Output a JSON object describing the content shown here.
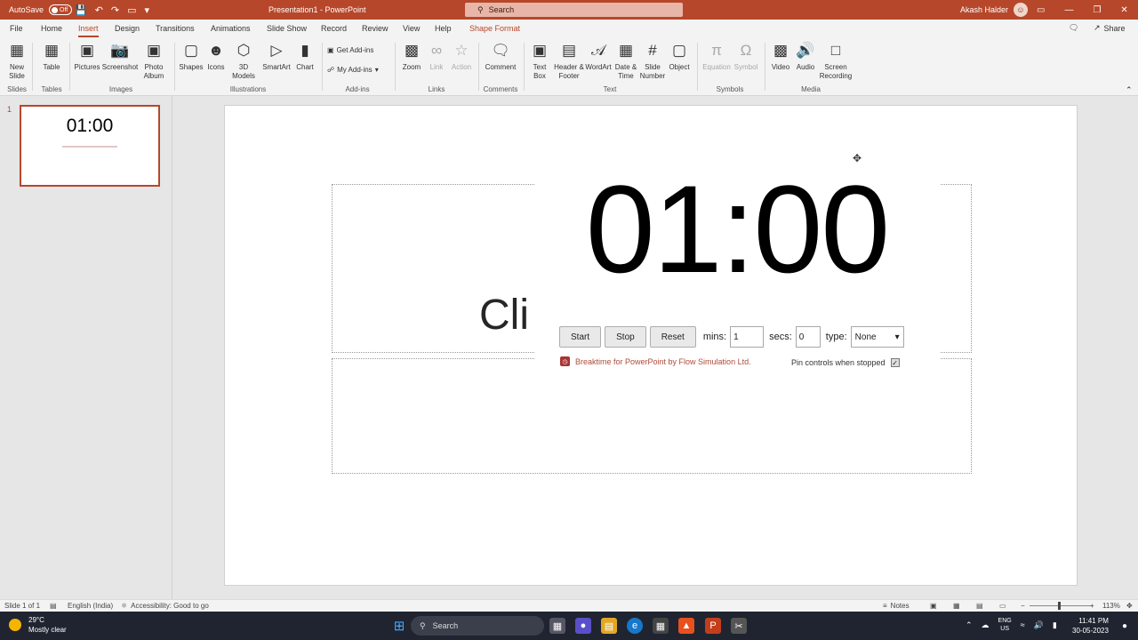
{
  "titlebar": {
    "autosave_label": "AutoSave",
    "autosave_state": "Off",
    "document_title": "Presentation1 - PowerPoint",
    "search_placeholder": "Search",
    "user_name": "Akash Halder"
  },
  "tabs": [
    "File",
    "Home",
    "Insert",
    "Design",
    "Transitions",
    "Animations",
    "Slide Show",
    "Record",
    "Review",
    "View",
    "Help",
    "Shape Format"
  ],
  "active_tab": "Insert",
  "share_label": "Share",
  "ribbon": {
    "new_slide": "New Slide",
    "table": "Table",
    "pictures": "Pictures",
    "screenshot": "Screenshot",
    "photo_album": "Photo Album",
    "shapes": "Shapes",
    "icons": "Icons",
    "models_3d": "3D Models",
    "smartart": "SmartArt",
    "chart": "Chart",
    "get_addins": "Get Add-ins",
    "my_addins": "My Add-ins",
    "zoom": "Zoom",
    "link": "Link",
    "action": "Action",
    "comment": "Comment",
    "text_box": "Text Box",
    "header_footer": "Header & Footer",
    "wordart": "WordArt",
    "date_time": "Date & Time",
    "slide_number": "Slide Number",
    "object": "Object",
    "equation": "Equation",
    "symbol": "Symbol",
    "video": "Video",
    "audio": "Audio",
    "screen_recording": "Screen Recording",
    "groups": {
      "slides": "Slides",
      "tables": "Tables",
      "images": "Images",
      "illustrations": "Illustrations",
      "addins": "Add-ins",
      "links": "Links",
      "comments": "Comments",
      "text": "Text",
      "symbols": "Symbols",
      "media": "Media"
    }
  },
  "thumbnail": {
    "number": "1",
    "time": "01:00"
  },
  "slide": {
    "timer_display": "01:00",
    "placeholder_text": "Cli",
    "controls": {
      "start": "Start",
      "stop": "Stop",
      "reset": "Reset",
      "mins_label": "mins:",
      "mins_value": "1",
      "secs_label": "secs:",
      "secs_value": "0",
      "type_label": "type:",
      "type_value": "None"
    },
    "brand_text": "Breaktime for PowerPoint by Flow Simulation Ltd.",
    "pin_label": "Pin controls when stopped"
  },
  "statusbar": {
    "slide_count": "Slide 1 of 1",
    "language": "English (India)",
    "accessibility": "Accessibility: Good to go",
    "notes": "Notes",
    "zoom": "113%"
  },
  "taskbar": {
    "temperature": "29°C",
    "weather": "Mostly clear",
    "search": "Search",
    "lang_top": "ENG",
    "lang_bottom": "US",
    "time": "11:41 PM",
    "date": "30-05-2023"
  }
}
